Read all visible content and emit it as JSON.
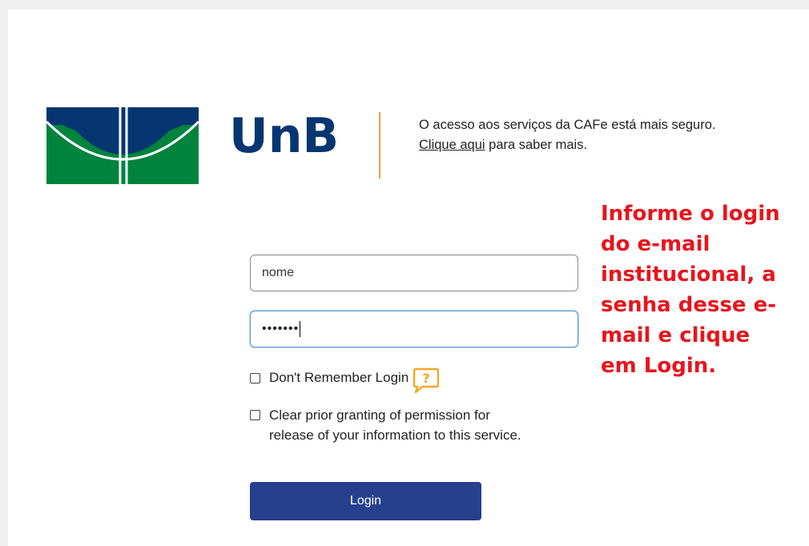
{
  "brand": {
    "logo_text": "UnB",
    "accent_blue": "#063672",
    "accent_green": "#00843d",
    "divider_color": "#e3a23a"
  },
  "notice": {
    "text": "O acesso aos serviços da CAFe está mais seguro.",
    "link_label": "Clique aqui",
    "link_suffix": " para saber mais."
  },
  "annotation": {
    "text": "Informe o login\ndo e-mail\ninstitucional, a\nsenha desse e-\nmail e clique\nem Login.",
    "color": "#e8141c"
  },
  "form": {
    "username_value": "nome",
    "password_value": "•••••••",
    "dont_remember_label": "Don't Remember Login",
    "help_icon": "question-bubble-icon",
    "clear_permission_label_line1": "Clear prior granting of permission for",
    "clear_permission_label_line2": "release of your information to this service.",
    "login_button_label": "Login",
    "button_color": "#26408e"
  }
}
